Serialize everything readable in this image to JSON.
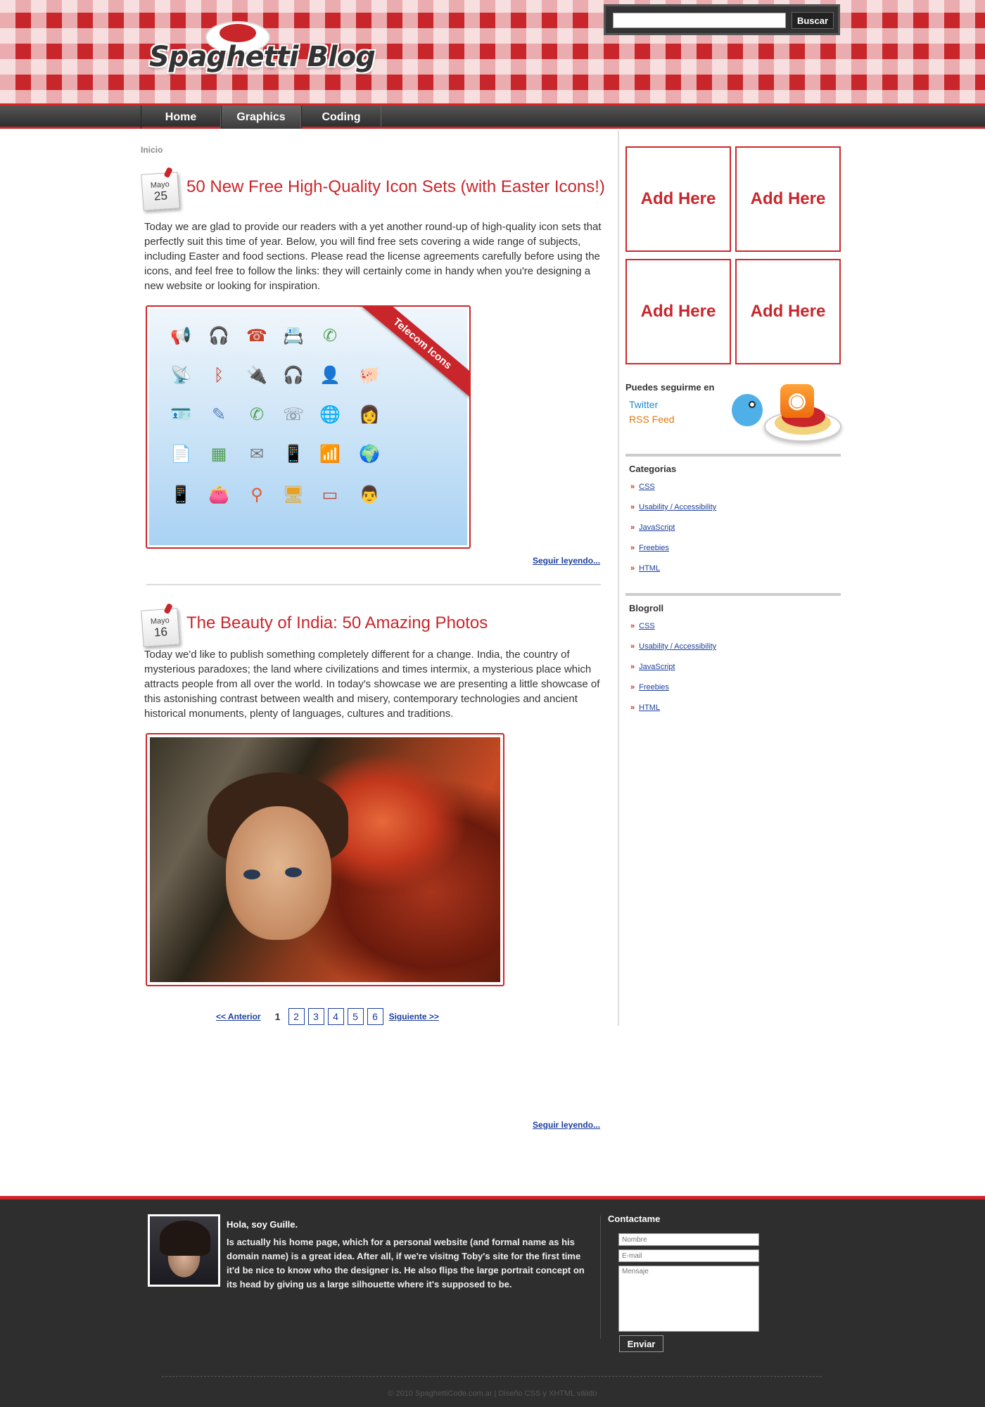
{
  "header": {
    "logo_text": "Spaghetti Blog",
    "search": {
      "placeholder": "",
      "button_label": "Buscar"
    }
  },
  "nav": {
    "items": [
      {
        "label": "Home"
      },
      {
        "label": "Graphics"
      },
      {
        "label": "Coding"
      }
    ],
    "active": "Graphics"
  },
  "breadcrumb": "Inicio",
  "posts": [
    {
      "month": "Mayo",
      "day": "25",
      "title": "50 New Free High-Quality Icon Sets (with Easter Icons!)",
      "body": "Today we are glad to provide our readers with a yet another round-up of high-quality icon sets that perfectly suit this time of year. Below, you will find free sets covering a wide range of subjects, including Easter and food sections. Please read the license agreements carefully before using the icons, and feel free to follow the links: they will certainly come in handy when you're designing a new website or looking for inspiration.",
      "image_ribbon": "Telecom Icons",
      "read_more": "Seguir leyendo..."
    },
    {
      "month": "Mayo",
      "day": "16",
      "title": "The Beauty of India: 50 Amazing Photos",
      "body": "Today we'd like to publish something completely different for a change. India, the country of mysterious paradoxes; the land where civilizations and times intermix, a mysterious place which attracts people from all over the world. In today's showcase we are presenting a little showcase of this astonishing contrast between wealth and misery, contemporary technologies and ancient historical monuments, plenty of languages, cultures and traditions.",
      "read_more": "Seguir leyendo..."
    }
  ],
  "icon_set_icons": [
    "megaphone-icon",
    "headset-icon",
    "phone-icon",
    "badge-icon",
    "phone-green-icon",
    "corner-icon",
    "satellite-icon",
    "bluetooth-icon",
    "usb-plug-icon",
    "headphones-icon",
    "operator-icon",
    "piggy-bank-icon",
    "id-card-icon",
    "pen-icon",
    "handset-icon",
    "desk-phone-icon",
    "globe-network-icon",
    "woman-operator-icon",
    "document-icon",
    "calculator-icon",
    "mail-lock-icon",
    "mobile-mail-icon",
    "wifi-icon",
    "globe-lock-icon",
    "mobile-icon",
    "wallet-icon",
    "lamp-icon",
    "monitor-icon",
    "usb-stick-icon",
    "man-operator-icon"
  ],
  "pagination": {
    "prev": "<< Anterior",
    "current": "1",
    "pages": [
      "2",
      "3",
      "4",
      "5",
      "6"
    ],
    "next": "Siguiente >>"
  },
  "sidebar": {
    "ads": [
      "Add Here",
      "Add Here",
      "Add Here",
      "Add Here"
    ],
    "follow": {
      "title": "Puedes seguirme en",
      "twitter": "Twitter",
      "rss": "RSS Feed"
    },
    "categories": {
      "title": "Categorias",
      "items": [
        "CSS",
        "Usability / Accessibility",
        "JavaScript",
        "Freebies",
        "HTML"
      ]
    },
    "blogroll": {
      "title": "Blogroll",
      "items": [
        "CSS",
        "Usability / Accessibility",
        "JavaScript",
        "Freebies",
        "HTML"
      ]
    }
  },
  "footer": {
    "about_title": "Hola, soy Guille.",
    "about_text": "Is actually his home page, which for a personal website (and formal name as his domain name) is a great idea. After all, if we're visitng Toby's site for the first time it'd be nice to know who the designer is. He also flips the large portrait concept on its head by giving us a large silhouette where it's supposed to be.",
    "contact_title": "Contactame",
    "name_placeholder": "Nombre",
    "email_placeholder": "E-mail",
    "message_placeholder": "Mensaje",
    "send_label": "Enviar",
    "copyright": "© 2010 SpaghettiCode.com.ar | Diseño CSS y XHTML válido"
  },
  "colors": {
    "brand_red": "#c9262b",
    "link_blue": "#1c3f9c",
    "footer_bg": "#2e2e2e"
  }
}
